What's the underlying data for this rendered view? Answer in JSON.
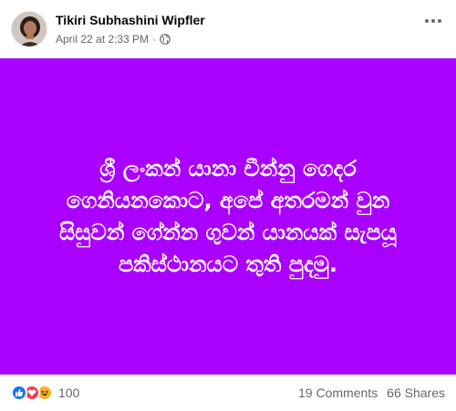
{
  "post": {
    "author": "Tikiri Subhashini Wipfler",
    "timestamp": "April 22 at 2:33 PM",
    "separator": "·",
    "audience_icon": "globe-icon",
    "more_icon": "more-options-icon",
    "background_color": "#aa00ff",
    "text": "ශ්‍රී ලංකන් යානා චීන්නු ගෙදර\nගෙනියනකොට, අපේ අතරමන් වුන\nසිසුවන් ගේන්න ගුවන් යානයක් සැපයූ\nපකිස්ථානයට තුති පුදමු."
  },
  "footer": {
    "reaction_icons": [
      "like-icon",
      "love-icon",
      "haha-icon"
    ],
    "reaction_count": "100",
    "comments": "19 Comments",
    "shares": "66 Shares"
  }
}
